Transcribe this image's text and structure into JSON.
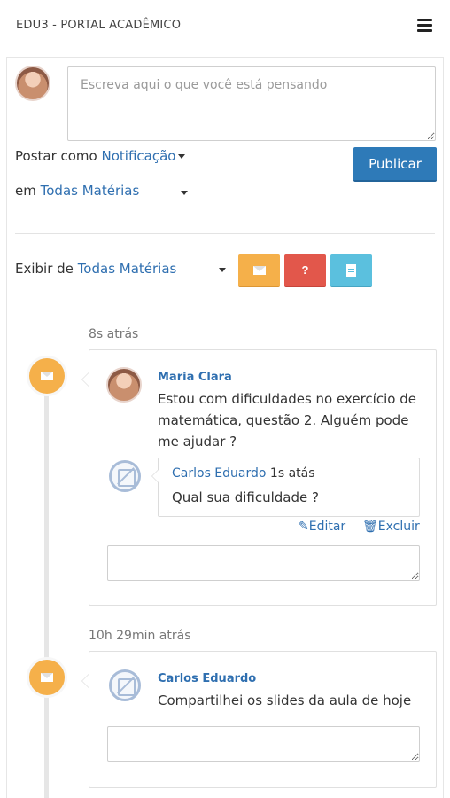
{
  "header": {
    "title": "EDU3 - PORTAL ACADÊMICO",
    "menu_icon": "hamburger-menu-icon"
  },
  "compose": {
    "placeholder": "Escreva aqui o que você está pensando",
    "post_as_label": "Postar como",
    "post_as_value": "Notificação",
    "in_label": "em",
    "in_value": "Todas Matérias",
    "publish_label": "Publicar"
  },
  "filter": {
    "label": "Exibir de",
    "value": "Todas Matérias",
    "buttons": [
      {
        "icon": "envelope-icon",
        "color": "#f5b04a"
      },
      {
        "icon": "question-icon",
        "color": "#e2574b",
        "glyph": "?"
      },
      {
        "icon": "document-icon",
        "color": "#5bc0de"
      }
    ]
  },
  "timeline": [
    {
      "time": "8s atrás",
      "icon": "envelope-icon",
      "author": "Maria Clara",
      "text": "Estou com dificuldades no exercício de matemática, questão 2. Alguém pode me ajudar ?",
      "reply": {
        "author": "Carlos Eduardo",
        "time": "1s atás",
        "text": "Qual sua dificuldade ?",
        "edit_label": "Editar",
        "delete_label": "Excluir"
      }
    },
    {
      "time": "10h 29min atrás",
      "icon": "envelope-icon",
      "author": "Carlos Eduardo",
      "text": "Compartilhei os slides da aula de hoje"
    }
  ],
  "colors": {
    "primary": "#2e7ab8",
    "link": "#2f6fb0",
    "orange": "#f5b04a",
    "red": "#e2574b",
    "cyan": "#5bc0de"
  }
}
